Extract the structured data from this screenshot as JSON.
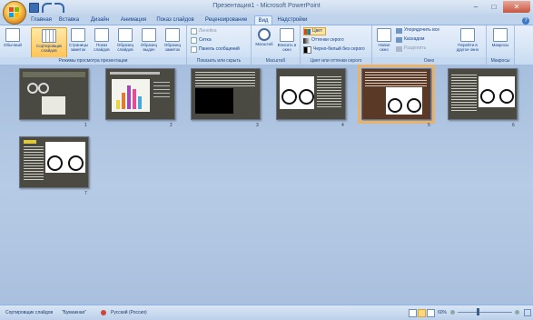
{
  "window": {
    "title": "Презентация1 - Microsoft PowerPoint",
    "controls": [
      "–",
      "□",
      "✕"
    ]
  },
  "tabs": [
    "Главная",
    "Вставка",
    "Дизайн",
    "Анимация",
    "Показ слайдов",
    "Рецензирование",
    "Вид",
    "Надстройки"
  ],
  "active_tab": "Вид",
  "ribbon": {
    "groups": {
      "views": {
        "label": "Режимы просмотра презентации",
        "buttons": [
          "Обычный",
          "Сортировщик слайдов",
          "Страницы заметок",
          "Показ слайдов",
          "Образец слайдов",
          "Образец выдач",
          "Образец заметок"
        ]
      },
      "show_hide": {
        "label": "Показать или скрыть",
        "items": [
          "Линейка",
          "Сетка",
          "Панель сообщений"
        ]
      },
      "zoom": {
        "label": "Масштаб",
        "buttons": [
          "Масштаб",
          "Вписать в окно"
        ]
      },
      "color": {
        "label": "Цвет или оттенки серого",
        "items": [
          "Цвет",
          "Оттенки серого",
          "Черно-белый без серого"
        ]
      },
      "window_group": {
        "label": "Окно",
        "new_window": "Новое окно",
        "items": [
          "Упорядочить все",
          "Каскадом",
          "Разделить"
        ],
        "switch": "Перейти в другое окно"
      },
      "macros": {
        "label": "Макросы",
        "button": "Макросы"
      }
    }
  },
  "slides": [
    {
      "number": "1"
    },
    {
      "number": "2"
    },
    {
      "number": "3"
    },
    {
      "number": "4"
    },
    {
      "number": "5",
      "selected": true
    },
    {
      "number": "6"
    },
    {
      "number": "7"
    }
  ],
  "statusbar": {
    "mode": "Сортировщик слайдов",
    "theme": "\"Бумажная\"",
    "language": "Русский (Россия)",
    "zoom": "60%"
  },
  "colors": {
    "workspace": "#a9c0de",
    "slide_dark": "#4a4a42",
    "selection": "#e8b26a",
    "accent": "#15428b"
  }
}
